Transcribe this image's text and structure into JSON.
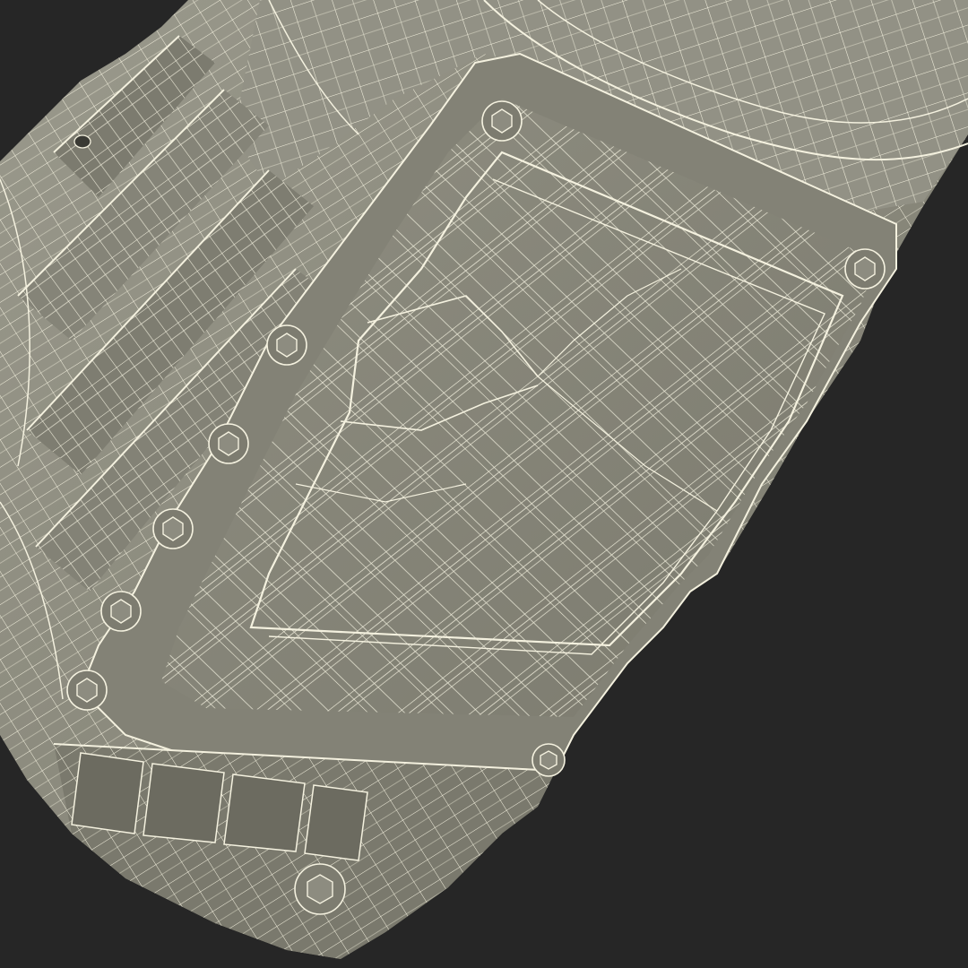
{
  "scene": {
    "subject": "oil-pan-wireframe-render",
    "colors": {
      "background": "#262626",
      "surface": "#8a897c",
      "surface_dark": "#6e6d62",
      "surface_light": "#a09f92",
      "wire": "#f4f1df",
      "bolt": "#7d7c70"
    },
    "bolt_count": 9
  }
}
